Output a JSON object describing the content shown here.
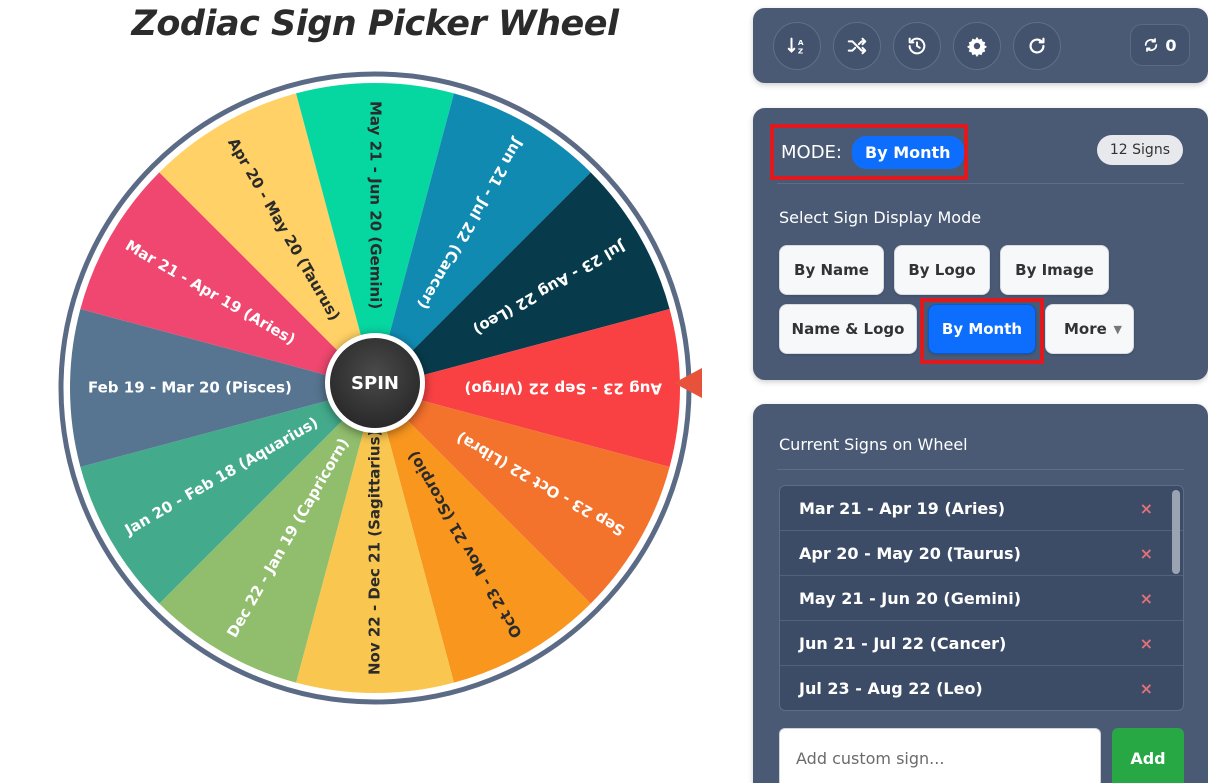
{
  "title": "Zodiac Sign Picker Wheel",
  "spin_label": "SPIN",
  "wheel": {
    "segments": [
      {
        "label": "Mar 21 - Apr 19 (Aries)",
        "color": "#ef476f",
        "text_color": "#ffffff"
      },
      {
        "label": "Apr 20 - May 20 (Taurus)",
        "color": "#ffd166",
        "text_color": "#2b2b2b"
      },
      {
        "label": "May 21 - Jun 20 (Gemini)",
        "color": "#06d6a0",
        "text_color": "#2b2b2b"
      },
      {
        "label": "Jun 21 - Jul 22 (Cancer)",
        "color": "#118ab2",
        "text_color": "#ffffff"
      },
      {
        "label": "Jul 23 - Aug 22 (Leo)",
        "color": "#073b4c",
        "text_color": "#ffffff"
      },
      {
        "label": "Aug 23 - Sep 22 (Virgo)",
        "color": "#f94144",
        "text_color": "#ffffff"
      },
      {
        "label": "Sep 23 - Oct 22 (Libra)",
        "color": "#f3722c",
        "text_color": "#ffffff"
      },
      {
        "label": "Oct 23 - Nov 21 (Scorpio)",
        "color": "#f8961e",
        "text_color": "#2b2b2b"
      },
      {
        "label": "Nov 22 - Dec 21 (Sagittarius)",
        "color": "#f9c74f",
        "text_color": "#2b2b2b"
      },
      {
        "label": "Dec 22 - Jan 19 (Capricorn)",
        "color": "#90be6d",
        "text_color": "#ffffff"
      },
      {
        "label": "Jan 20 - Feb 18 (Aquarius)",
        "color": "#43aa8b",
        "text_color": "#ffffff"
      },
      {
        "label": "Feb 19 - Mar 20 (Pisces)",
        "color": "#577590",
        "text_color": "#ffffff"
      }
    ],
    "pointer_color": "#e8523a"
  },
  "toolbar": {
    "icons": [
      "sort-icon",
      "shuffle-icon",
      "history-icon",
      "gear-icon",
      "redo-icon"
    ],
    "spin_count": "0"
  },
  "mode_panel": {
    "mode_label": "MODE:",
    "mode_value": "By Month",
    "count_badge": "12 Signs",
    "section_title": "Select Sign Display Mode",
    "options": {
      "by_name": "By Name",
      "by_logo": "By Logo",
      "by_image": "By Image",
      "name_logo": "Name & Logo",
      "by_month": "By Month",
      "more": "More"
    }
  },
  "list_panel": {
    "title": "Current Signs on Wheel",
    "items": [
      "Mar 21 - Apr 19 (Aries)",
      "Apr 20 - May 20 (Taurus)",
      "May 21 - Jun 20 (Gemini)",
      "Jun 21 - Jul 22 (Cancer)",
      "Jul 23 - Aug 22 (Leo)"
    ],
    "remove_symbol": "×",
    "input_placeholder": "Add custom sign...",
    "add_label": "Add"
  },
  "colors": {
    "panel_bg": "#4a5a75",
    "accent": "#0d6efd",
    "highlight": "#e0191e",
    "add_green": "#28a745"
  }
}
